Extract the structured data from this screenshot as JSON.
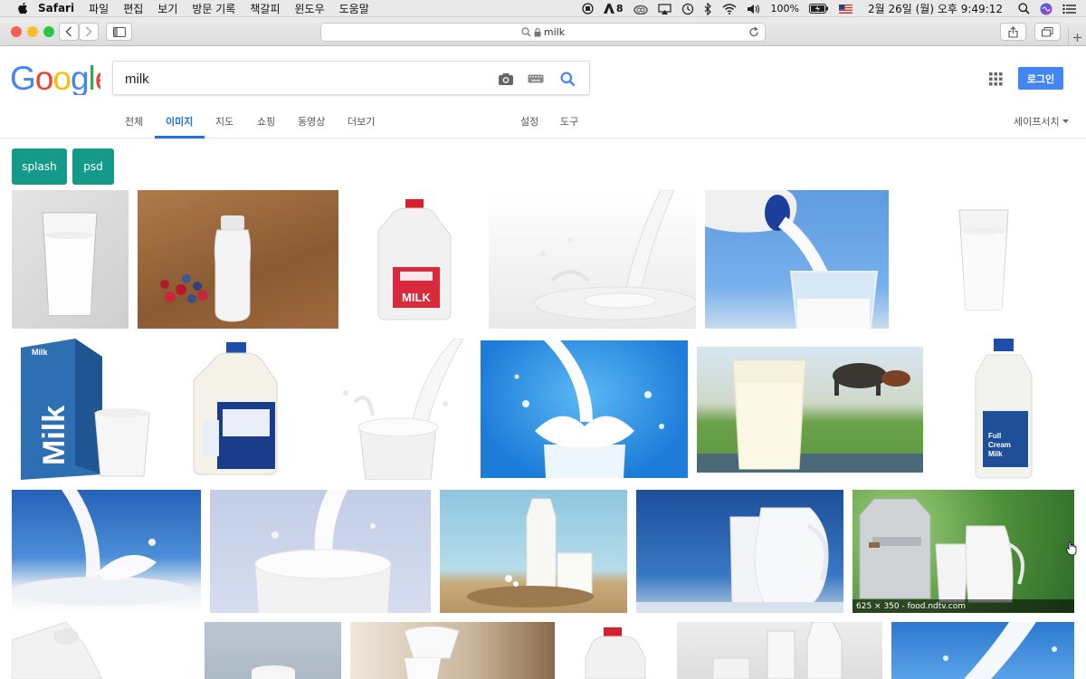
{
  "menubar": {
    "app": "Safari",
    "items": [
      "파일",
      "편집",
      "보기",
      "방문 기록",
      "책갈피",
      "윈도우",
      "도움말"
    ],
    "adobe_count": "8",
    "battery": "100%",
    "datetime": "2월 26일 (월) 오후 9:49:12"
  },
  "browser": {
    "url": "milk"
  },
  "google": {
    "logo": "Google",
    "query": "milk",
    "login": "로그인",
    "tabs": [
      "전체",
      "이미지",
      "지도",
      "쇼핑",
      "동영상",
      "더보기"
    ],
    "settings": "설정",
    "tools": "도구",
    "safesearch": "세이프서치"
  },
  "chips": [
    "splash",
    "psd"
  ],
  "hover_caption": "625 × 350 - food.ndtv.com",
  "colors": {
    "google_blue": "#4285F4",
    "google_red": "#EA4335",
    "google_yellow": "#FBBC05",
    "google_green": "#34A853",
    "chip": "#159A8A"
  }
}
